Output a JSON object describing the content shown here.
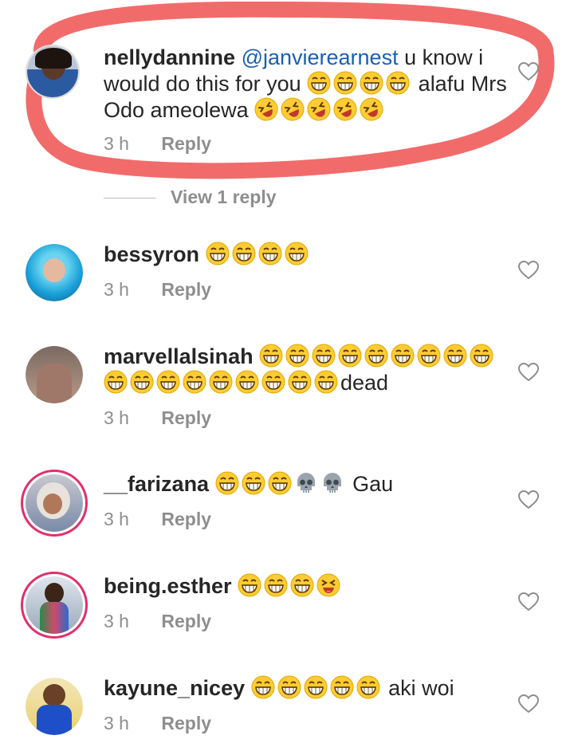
{
  "comments": [
    {
      "username": "nellydannine",
      "mention": "@janvierearnest",
      "text_parts": [
        "u know i would do this for you",
        "alafu Mrs Odo ameolewa"
      ],
      "time": "3 h",
      "reply_label": "Reply",
      "avatar_icon": "profile-photo",
      "highlighted": true
    },
    {
      "username": "bessyron",
      "text": "",
      "time": "3 h",
      "reply_label": "Reply",
      "avatar_icon": "profile-photo"
    },
    {
      "username": "marvellalsinah",
      "text": "dead",
      "time": "3 h",
      "reply_label": "Reply",
      "avatar_icon": "profile-photo"
    },
    {
      "username": "__farizana",
      "text": "Gau",
      "time": "3 h",
      "reply_label": "Reply",
      "avatar_icon": "profile-photo-story-ring"
    },
    {
      "username": "being.esther",
      "text": "",
      "time": "3 h",
      "reply_label": "Reply",
      "avatar_icon": "profile-photo-story-ring"
    },
    {
      "username": "kayune_nicey",
      "text": "aki woi",
      "time": "3 h",
      "reply_label": "Reply",
      "avatar_icon": "profile-photo"
    }
  ],
  "view_replies": "View 1 reply",
  "colors": {
    "highlight": "#f26b6b",
    "mention": "#1a5fb4",
    "story_ring": "#e1306c"
  }
}
